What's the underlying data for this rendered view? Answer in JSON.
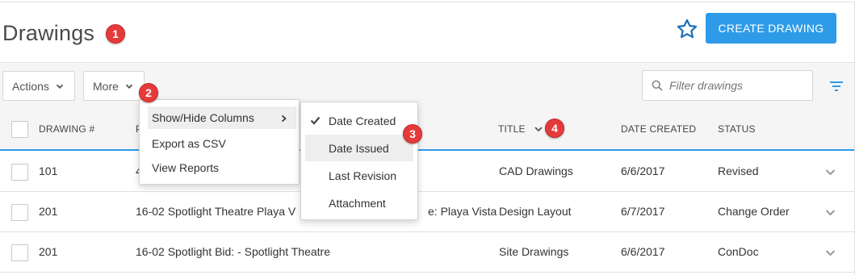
{
  "header": {
    "title": "Drawings",
    "create_label": "CREATE DRAWING"
  },
  "badges": [
    "1",
    "2",
    "3",
    "4"
  ],
  "toolbar": {
    "actions_label": "Actions",
    "more_label": "More",
    "filter_placeholder": "Filter drawings"
  },
  "table": {
    "columns": {
      "drawing_no": "DRAWING #",
      "project_partial": "P",
      "title": "TITLE",
      "date_created": "DATE CREATED",
      "status": "STATUS"
    },
    "rows": [
      {
        "drawing_no": "101",
        "project": "4",
        "title": "CAD Drawings",
        "date_created": "6/6/2017",
        "status": "Revised"
      },
      {
        "drawing_no": "201",
        "project": "16-02 Spotlight Theatre Playa V",
        "project_tail": "e: Playa Vista",
        "title": "Design Layout",
        "date_created": "6/7/2017",
        "status": "Change Order"
      },
      {
        "drawing_no": "201",
        "project": "16-02 Spotlight Bid: - Spotlight Theatre",
        "title": "Site Drawings",
        "date_created": "6/6/2017",
        "status": "ConDoc"
      }
    ]
  },
  "more_menu": {
    "items": [
      "Show/Hide Columns",
      "Export as CSV",
      "View Reports"
    ]
  },
  "columns_submenu": {
    "items": [
      {
        "label": "Date Created",
        "checked": true
      },
      {
        "label": "Date Issued",
        "checked": false
      },
      {
        "label": "Last Revision",
        "checked": false
      },
      {
        "label": "Attachment",
        "checked": false
      }
    ]
  },
  "colors": {
    "accent": "#2e9be8",
    "badge": "#e63a3a"
  },
  "icons": [
    "star-icon",
    "chevron-down-icon",
    "search-icon",
    "filter-icon",
    "chevron-right-icon",
    "check-icon"
  ]
}
